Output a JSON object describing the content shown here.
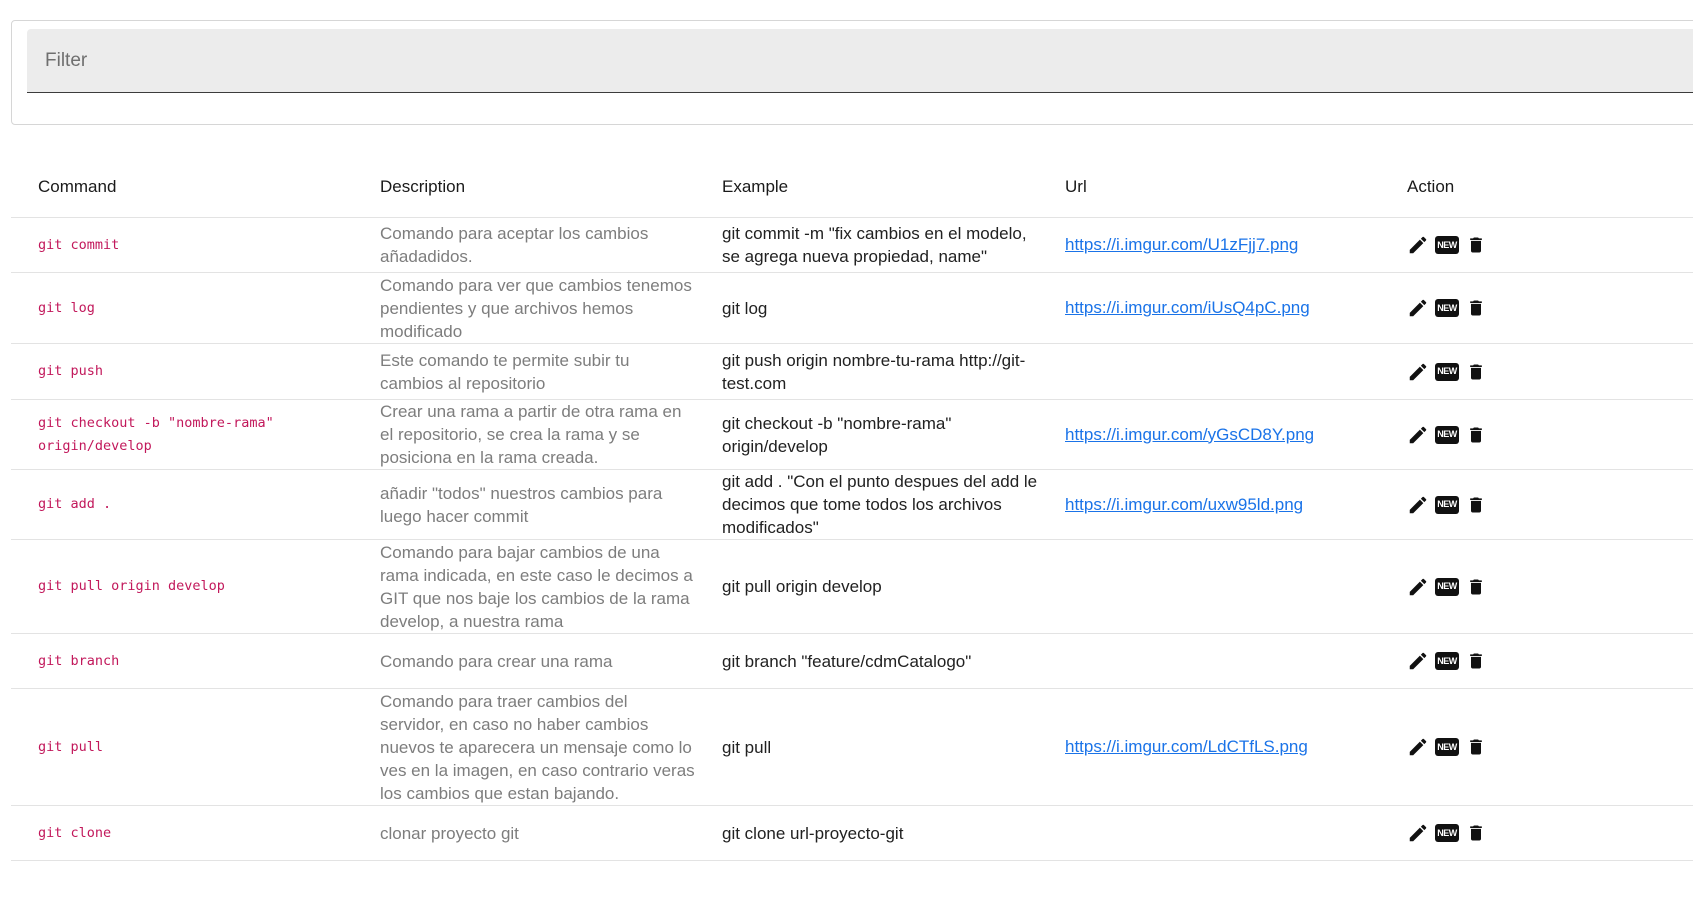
{
  "filter": {
    "placeholder": "Filter",
    "value": ""
  },
  "table": {
    "headers": [
      "Command",
      "Description",
      "Example",
      "Url",
      "Action"
    ],
    "rows": [
      {
        "command": "git commit",
        "description": "Comando para aceptar los cambios añadadidos.",
        "example": "git commit -m \"fix cambios en el modelo, se agrega nueva propiedad, name\"",
        "url": "https://i.imgur.com/U1zFjj7.png"
      },
      {
        "command": "git log",
        "description": "Comando para ver que cambios tenemos pendientes y que archivos hemos modificado",
        "example": "git log",
        "url": "https://i.imgur.com/iUsQ4pC.png"
      },
      {
        "command": "git push",
        "description": "Este comando te permite subir tu cambios al repositorio",
        "example": "git push origin nombre-tu-rama http://git-test.com",
        "url": ""
      },
      {
        "command": "git checkout -b \"nombre-rama\" origin/develop",
        "description": "Crear una rama a partir de otra rama en el repositorio, se crea la rama y se posiciona en la rama creada.",
        "example": "git checkout -b \"nombre-rama\" origin/develop",
        "url": "https://i.imgur.com/yGsCD8Y.png"
      },
      {
        "command": "git add .",
        "description": "añadir \"todos\" nuestros cambios para luego hacer commit",
        "example": "git add . \"Con el punto despues del add le decimos que tome todos los archivos modificados\"",
        "url": "https://i.imgur.com/uxw95ld.png"
      },
      {
        "command": "git pull origin develop",
        "description": "Comando para bajar cambios de una rama indicada, en este caso le decimos a GIT que nos baje los cambios de la rama develop, a nuestra rama",
        "example": "git pull origin develop",
        "url": ""
      },
      {
        "command": "git branch",
        "description": "Comando para crear una rama",
        "example": "git branch \"feature/cdmCatalogo\"",
        "url": ""
      },
      {
        "command": "git pull",
        "description": "Comando para traer cambios del servidor, en caso no haber cambios nuevos te aparecera un mensaje como lo ves en la imagen, en caso contrario veras los cambios que estan bajando.",
        "example": "git pull",
        "url": "https://i.imgur.com/LdCTfLS.png"
      },
      {
        "command": "git clone",
        "description": "clonar proyecto git",
        "example": "git clone url-proyecto-git",
        "url": ""
      }
    ],
    "actions": {
      "edit_icon": "pencil-icon",
      "new_icon": "new-badge-icon",
      "new_label": "NEW",
      "delete_icon": "trash-icon"
    }
  },
  "colors": {
    "command_text": "#c2185b",
    "link": "#1a73e8",
    "description_text": "#7d7d7d"
  }
}
